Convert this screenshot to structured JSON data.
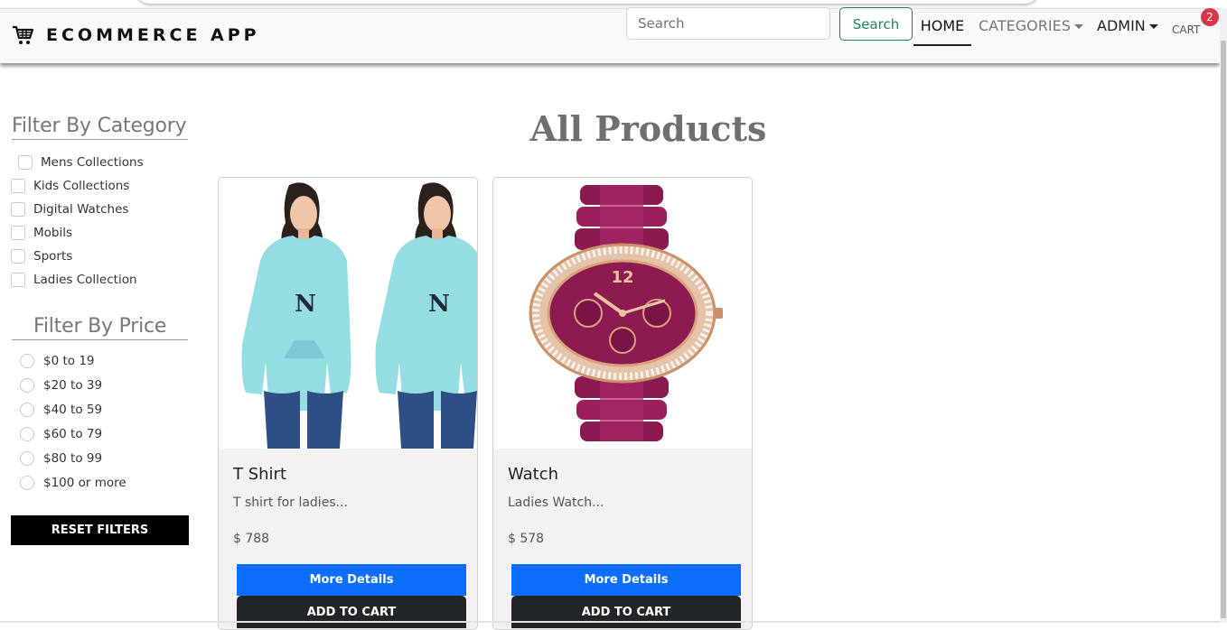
{
  "navbar": {
    "brand": "ECOMMERCE APP",
    "brand_icon": "cart-icon",
    "search_placeholder": "Search",
    "search_button": "Search",
    "home": "HOME",
    "categories": "CATEGORIES",
    "admin": "ADMIN",
    "cart": "CART",
    "cart_count": "2"
  },
  "sidebar": {
    "category_title": "Filter By Category",
    "categories": [
      "Mens Collections",
      "Kids Collections",
      "Digital Watches",
      "Mobils",
      "Sports",
      "Ladies Collection"
    ],
    "price_title": "Filter By Price",
    "prices": [
      "$0 to 19",
      "$20 to 39",
      "$40 to 59",
      "$60 to 79",
      "$80 to 99",
      "$100 or more"
    ],
    "reset_button": "RESET FILTERS"
  },
  "main": {
    "title": "All Products",
    "products": [
      {
        "name": "T Shirt",
        "description": "T shirt for ladies...",
        "price": "$ 788",
        "more_button": "More Details",
        "cart_button": "ADD TO CART"
      },
      {
        "name": "Watch",
        "description": "Ladies Watch...",
        "price": "$ 578",
        "more_button": "More Details",
        "cart_button": "ADD TO CART"
      }
    ]
  },
  "colors": {
    "accent_blue": "#0d6efd",
    "search_green": "#198754",
    "badge_red": "#dc3545",
    "dark_button": "#212529"
  }
}
